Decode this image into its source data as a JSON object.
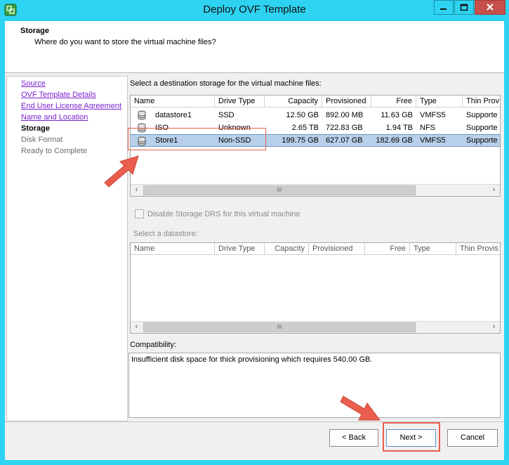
{
  "window": {
    "title": "Deploy OVF Template"
  },
  "header": {
    "title": "Storage",
    "subtitle": "Where do you want to store the virtual machine files?"
  },
  "nav": {
    "items": [
      {
        "label": "Source",
        "state": "link"
      },
      {
        "label": "OVF Template Details",
        "state": "link"
      },
      {
        "label": "End User License Agreement",
        "state": "link"
      },
      {
        "label": "Name and Location",
        "state": "link"
      },
      {
        "label": "Storage",
        "state": "current"
      },
      {
        "label": "Disk Format",
        "state": "disabled"
      },
      {
        "label": "Ready to Complete",
        "state": "disabled"
      }
    ]
  },
  "storage": {
    "prompt": "Select a destination storage for the virtual machine files:",
    "columns": [
      "Name",
      "Drive Type",
      "Capacity",
      "Provisioned",
      "Free",
      "Type",
      "Thin Prov"
    ],
    "rows": [
      {
        "name": "datastore1",
        "drive_type": "SSD",
        "capacity": "12.50 GB",
        "provisioned": "892.00 MB",
        "free": "11.63 GB",
        "type": "VMFS5",
        "thin": "Supporte"
      },
      {
        "name": "ISO",
        "drive_type": "Unknown",
        "capacity": "2.65 TB",
        "provisioned": "722.83 GB",
        "free": "1.94 TB",
        "type": "NFS",
        "thin": "Supporte"
      },
      {
        "name": "Store1",
        "drive_type": "Non-SSD",
        "capacity": "199.75 GB",
        "provisioned": "627.07 GB",
        "free": "182.69 GB",
        "type": "VMFS5",
        "thin": "Supporte",
        "selected": true
      }
    ],
    "scroll_thumb_glyph": "III"
  },
  "sdrs": {
    "checkbox_label": "Disable Storage DRS for this virtual machine",
    "checked": false
  },
  "datastore": {
    "prompt": "Select a datastore:",
    "columns": [
      "Name",
      "Drive Type",
      "Capacity",
      "Provisioned",
      "Free",
      "Type",
      "Thin Provis"
    ],
    "scroll_thumb_glyph": "III"
  },
  "compatibility": {
    "label": "Compatibility:",
    "message": "Insufficient disk space for thick provisioning which requires 540.00 GB."
  },
  "footer": {
    "back_label": "< Back",
    "next_label": "Next >",
    "cancel_label": "Cancel"
  },
  "colors": {
    "titlebar": "#2ed3f1",
    "close_button": "#c7504a",
    "highlight": "#ea5e4e",
    "selection": "#b8d0ea",
    "link": "#7a1fd1"
  }
}
